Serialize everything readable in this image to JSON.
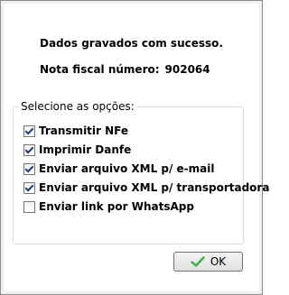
{
  "message": {
    "saved": "Dados gravados com sucesso.",
    "invoice_label": "Nota fiscal número:",
    "invoice_number": "902064"
  },
  "options": {
    "legend": "Selecione as opções:",
    "items": [
      {
        "label": "Transmitir NFe",
        "checked": true
      },
      {
        "label": "Imprimir Danfe",
        "checked": true
      },
      {
        "label": "Enviar arquivo XML p/ e-mail",
        "checked": true
      },
      {
        "label": "Enviar arquivo XML p/ transportadora",
        "checked": true
      },
      {
        "label": "Enviar link por WhatsApp",
        "checked": false
      }
    ]
  },
  "ok_button": {
    "label": "OK",
    "icon": "check-icon",
    "icon_color": "#3cb043"
  }
}
